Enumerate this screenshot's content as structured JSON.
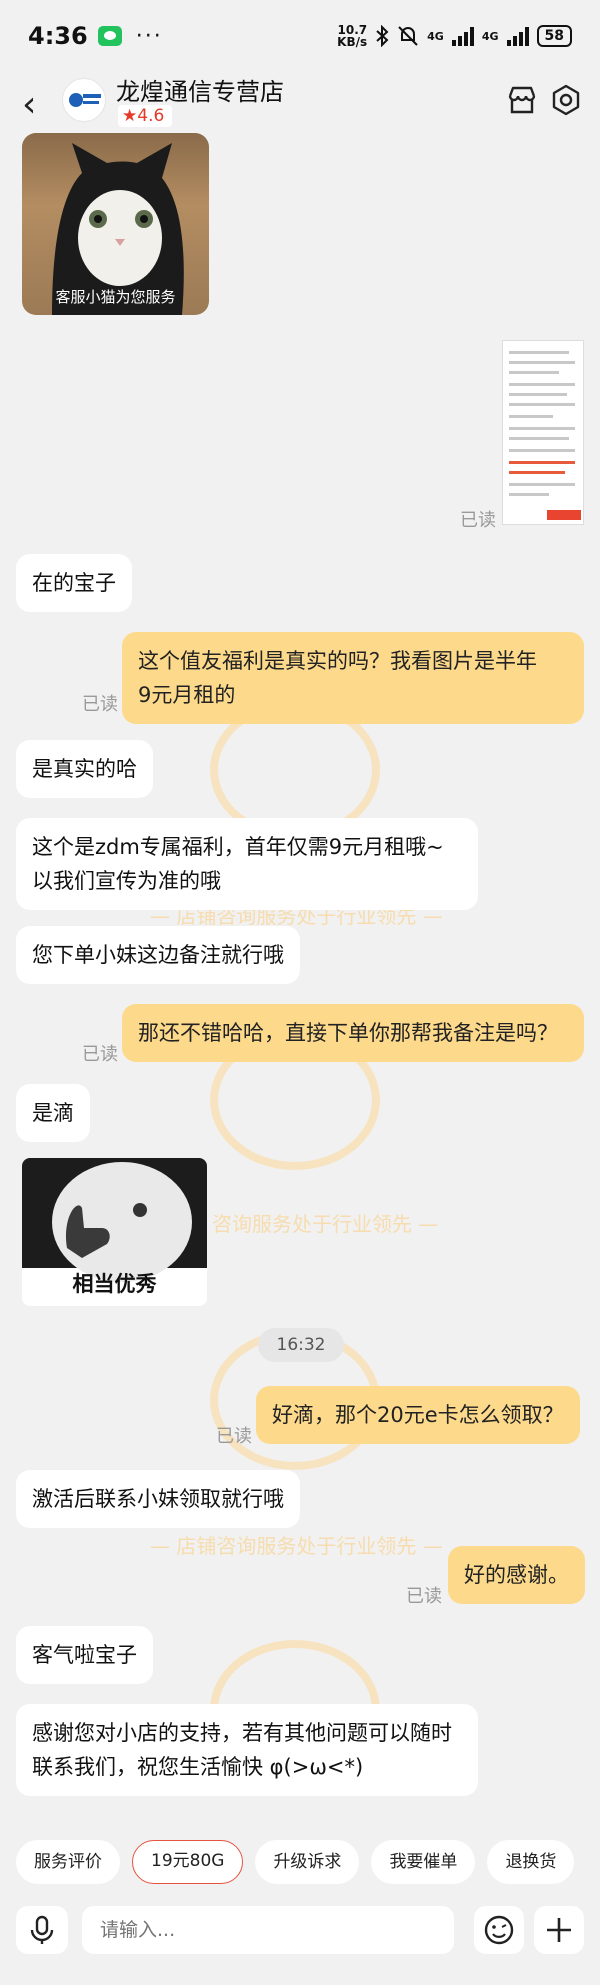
{
  "status_bar": {
    "time": "4:36",
    "dots": "···",
    "speed_value": "10.7",
    "speed_unit": "KB/s",
    "network1": "4G",
    "network2": "4G",
    "battery": "58"
  },
  "header": {
    "shop_name": "龙煌通信专营店",
    "rating": "4.6"
  },
  "card": {
    "caption": "客服小猫为您服务"
  },
  "read_label": "已读",
  "messages": [
    {
      "text": "在的宝子"
    },
    {
      "text": "这个值友福利是真实的吗？我看图片是半年\n9元月租的"
    },
    {
      "text": "是真实的哈"
    },
    {
      "text": "这个是zdm专属福利，首年仅需9元月租哦~\n以我们宣传为准的哦"
    },
    {
      "text": "您下单小妹这边备注就行哦"
    },
    {
      "text": "那还不错哈哈，直接下单你那帮我备注是吗？"
    },
    {
      "text": "是滴"
    },
    {
      "text": "好滴，那个20元e卡怎么领取？"
    },
    {
      "text": "激活后联系小妹领取就行哦"
    },
    {
      "text": "好的感谢。"
    },
    {
      "text": "客气啦宝子"
    },
    {
      "text": "感谢您对小店的支持，若有其他问题可以随时\n联系我们，祝您生活愉快 φ(>ω<*)"
    }
  ],
  "sticker": {
    "caption": "相当优秀"
  },
  "time_divider": "16:32",
  "watermark": {
    "text": "—  店铺咨询服务处于行业领先  —",
    "partial": "咨询服务处于行业领先  —"
  },
  "quick_actions": [
    "服务评价",
    "19元80G",
    "升级诉求",
    "我要催单",
    "退换货"
  ],
  "input": {
    "placeholder": "请输入..."
  },
  "colors": {
    "outgoing_bubble": "#fdd98c",
    "incoming_bubble": "#ffffff",
    "rating_red": "#e33a2a",
    "background": "#f1f1f1"
  }
}
